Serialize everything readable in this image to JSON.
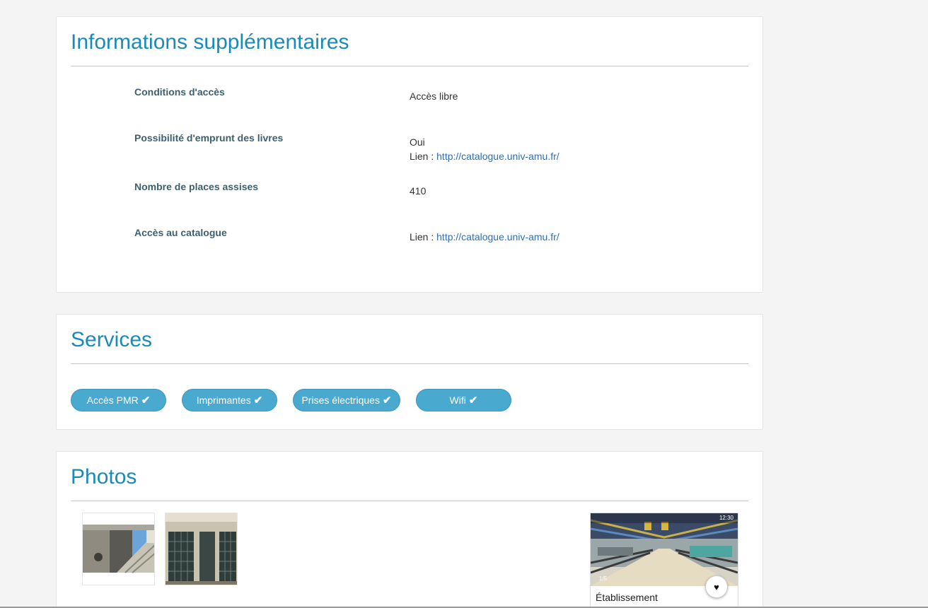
{
  "info_section": {
    "title": "Informations supplémentaires",
    "rows": [
      {
        "label": "Conditions d'accès",
        "value": "Accès libre"
      },
      {
        "label": "Possibilité d'emprunt des livres",
        "value": "Oui",
        "link_prefix": "Lien : ",
        "link": "http://catalogue.univ-amu.fr/"
      },
      {
        "label": "Nombre de places assises",
        "value": "410"
      },
      {
        "label": "Accès au catalogue",
        "link_prefix": "Lien : ",
        "link": "http://catalogue.univ-amu.fr/"
      }
    ]
  },
  "services_section": {
    "title": "Services",
    "items": [
      {
        "label": "Accès PMR",
        "icon": "check-icon"
      },
      {
        "label": "Imprimantes",
        "icon": "check-icon"
      },
      {
        "label": "Prises électriques",
        "icon": "check-icon"
      },
      {
        "label": "Wifi",
        "icon": "check-icon"
      }
    ]
  },
  "photos_section": {
    "title": "Photos",
    "thumbnails": [
      "photo-building-stairs",
      "photo-building-entrance"
    ],
    "card": {
      "label": "Établissement",
      "page_counter": "1/5",
      "status_time": "12:30",
      "favorite_icon": "heart-icon"
    }
  },
  "colors": {
    "accent": "#1a8ab7",
    "pill": "#4aa9ce",
    "label": "#3d5f6e",
    "link": "#2a70b8"
  }
}
